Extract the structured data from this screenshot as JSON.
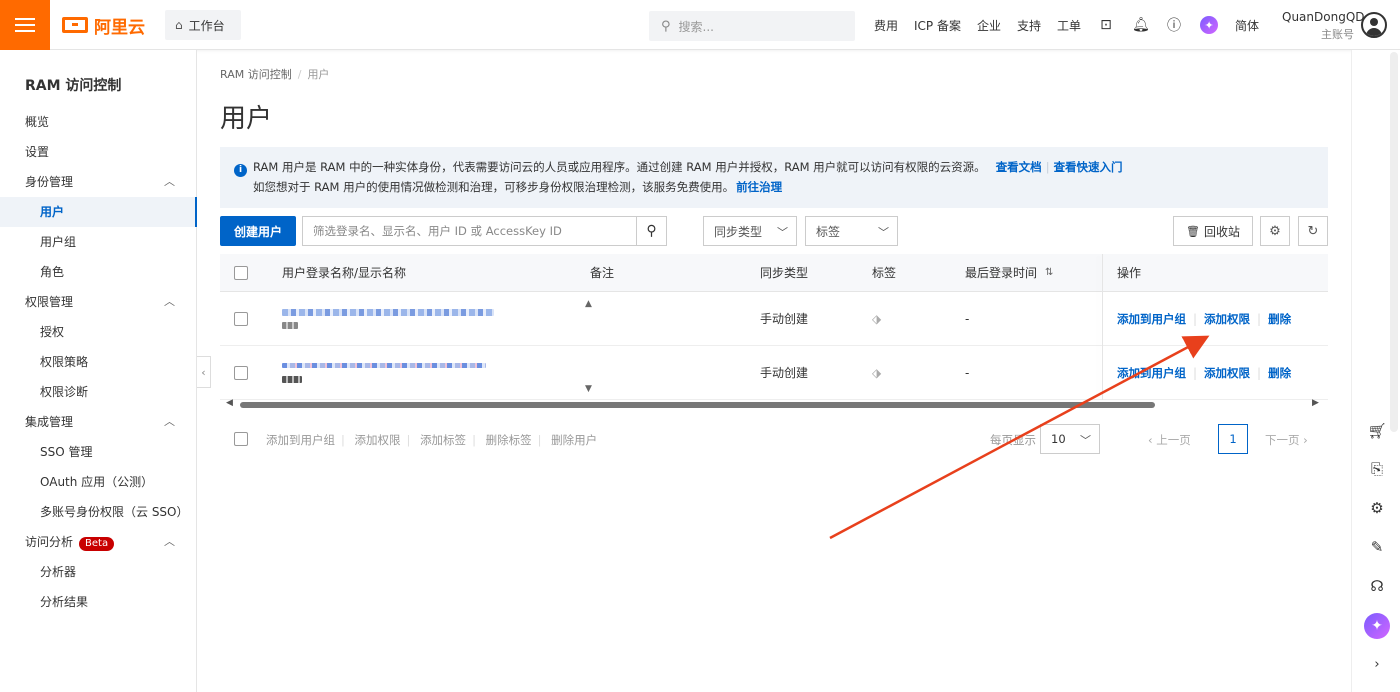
{
  "topbar": {
    "logo_text": "阿里云",
    "workbench_label": "工作台",
    "search_placeholder": "搜索...",
    "links": [
      "费用",
      "ICP 备案",
      "企业",
      "支持",
      "工单"
    ],
    "icons": [
      "terminal-icon",
      "bell-icon",
      "help-icon",
      "ai-assistant-icon"
    ],
    "lang": "简体",
    "user_name": "QuanDongQD",
    "user_role": "主账号"
  },
  "sidebar": {
    "title": "RAM 访问控制",
    "items": [
      {
        "label": "概览",
        "level": 1
      },
      {
        "label": "设置",
        "level": 1
      },
      {
        "label": "身份管理",
        "level": 1,
        "group": true
      },
      {
        "label": "用户",
        "level": 2,
        "active": true
      },
      {
        "label": "用户组",
        "level": 2
      },
      {
        "label": "角色",
        "level": 2
      },
      {
        "label": "权限管理",
        "level": 1,
        "group": true
      },
      {
        "label": "授权",
        "level": 2
      },
      {
        "label": "权限策略",
        "level": 2
      },
      {
        "label": "权限诊断",
        "level": 2
      },
      {
        "label": "集成管理",
        "level": 1,
        "group": true
      },
      {
        "label": "SSO 管理",
        "level": 2
      },
      {
        "label": "OAuth 应用（公测）",
        "level": 2
      },
      {
        "label": "多账号身份权限（云 SSO）",
        "level": 2
      },
      {
        "label": "访问分析",
        "level": 1,
        "group": true,
        "badge": "Beta"
      },
      {
        "label": "分析器",
        "level": 2
      },
      {
        "label": "分析结果",
        "level": 2
      }
    ]
  },
  "breadcrumb": {
    "root": "RAM 访问控制",
    "current": "用户"
  },
  "page_title": "用户",
  "notice": {
    "line1": "RAM 用户是 RAM 中的一种实体身份，代表需要访问云的人员或应用程序。通过创建 RAM 用户并授权，RAM 用户就可以访问有权限的云资源。",
    "link_docs": "查看文档",
    "link_quickstart": "查看快速入门",
    "line2": "如您想对于 RAM 用户的使用情况做检测和治理，可移步身份权限治理检测，该服务免费使用。",
    "link_govern": "前往治理"
  },
  "toolbar": {
    "create_label": "创建用户",
    "filter_placeholder": "筛选登录名、显示名、用户 ID 或 AccessKey ID",
    "sync_type_label": "同步类型",
    "tag_label": "标签",
    "recycle_label": "回收站"
  },
  "table": {
    "headers": {
      "name": "用户登录名称/显示名称",
      "note": "备注",
      "sync": "同步类型",
      "tag": "标签",
      "last_login": "最后登录时间",
      "ops": "操作"
    },
    "rows": [
      {
        "sync": "手动创建",
        "last_login": "-"
      },
      {
        "sync": "手动创建",
        "last_login": "-"
      }
    ],
    "op_labels": {
      "add_group": "添加到用户组",
      "add_perm": "添加权限",
      "delete": "删除"
    }
  },
  "footer": {
    "batch": [
      "添加到用户组",
      "添加权限",
      "添加标签",
      "删除标签",
      "删除用户"
    ],
    "per_page_label": "每页显示",
    "per_page_value": "10",
    "prev": "上一页",
    "page": "1",
    "next": "下一页"
  },
  "colors": {
    "brand": "#ff6a00",
    "primary": "#0064c8",
    "annotation_arrow": "#e8401c",
    "beta": "#c80000"
  }
}
